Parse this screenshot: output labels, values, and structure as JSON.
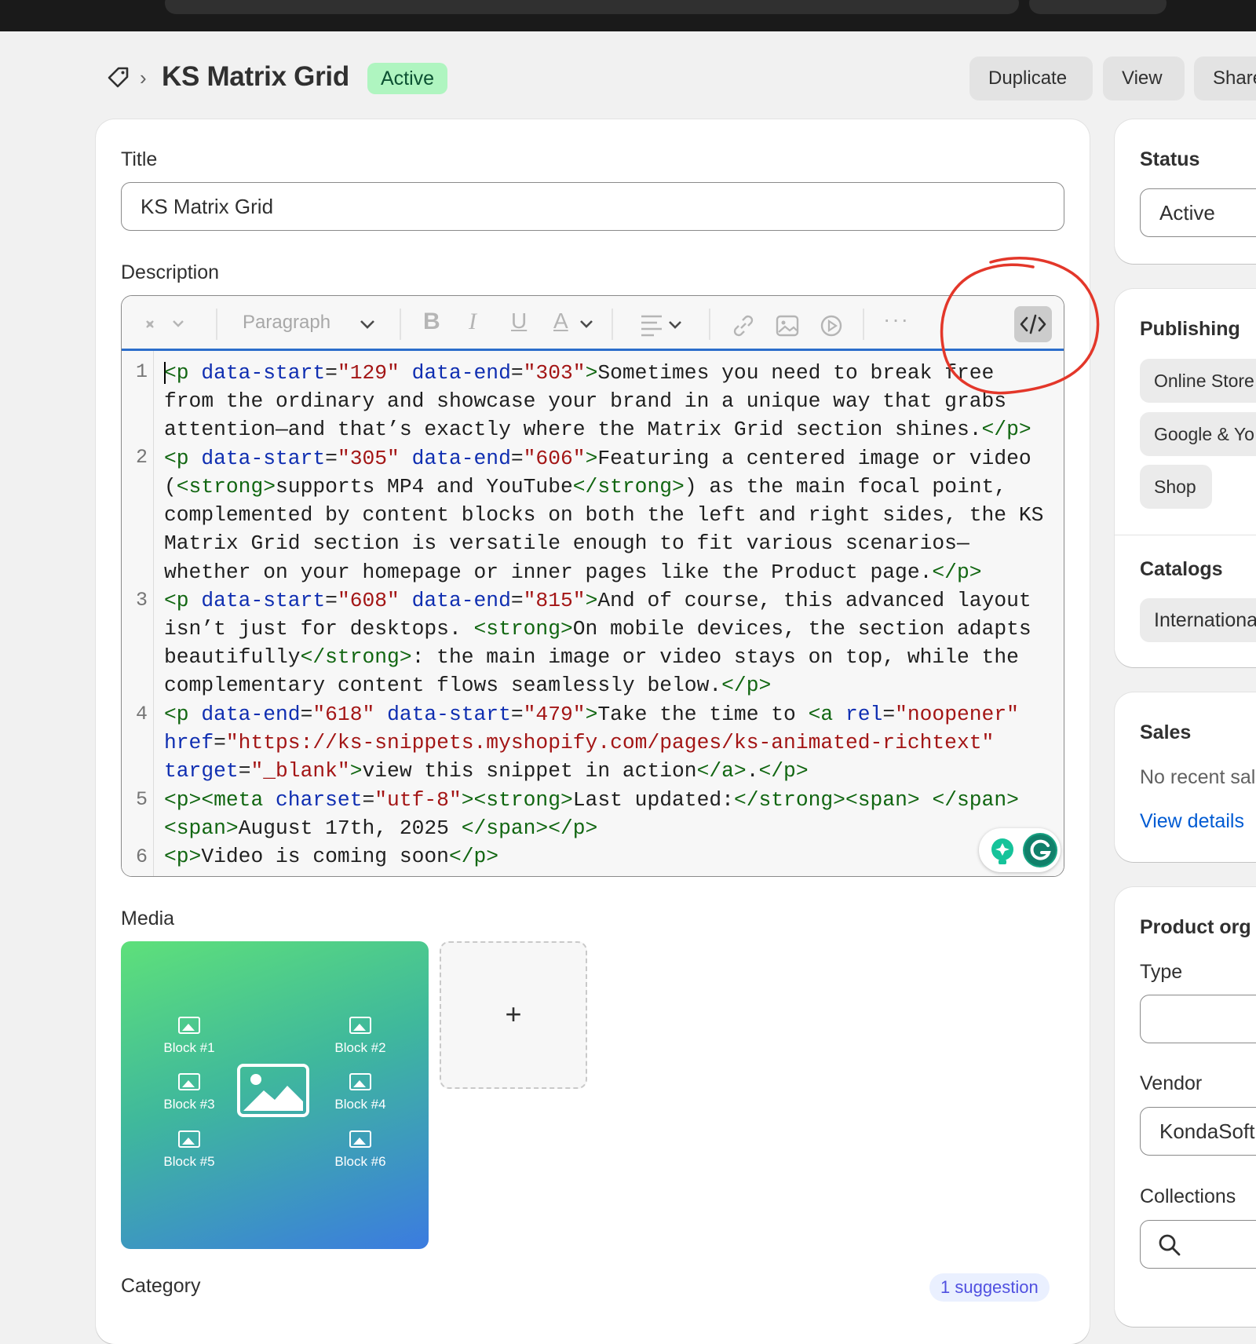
{
  "header": {
    "title": "KS Matrix Grid",
    "status_badge": "Active",
    "buttons": [
      "Duplicate",
      "View",
      "Share"
    ]
  },
  "main": {
    "title_label": "Title",
    "title_value": "KS Matrix Grid",
    "description_label": "Description",
    "toolbar": {
      "paragraph_select": "Paragraph",
      "icons": [
        "magic-icon",
        "bold-icon",
        "italic-icon",
        "underline-icon",
        "text-color-icon",
        "align-icon",
        "link-icon",
        "image-icon",
        "video-icon",
        "more-icon",
        "code-view-icon"
      ]
    },
    "code_line_numbers": [
      "1",
      "2",
      "3",
      "4",
      "5",
      "6"
    ],
    "media_label": "Media",
    "media_blocks": [
      "Block #1",
      "Block #2",
      "Block #3",
      "Block #4",
      "Block #5",
      "Block #6"
    ],
    "media_add": "+",
    "category_label": "Category",
    "category_suggestion": "1 suggestion"
  },
  "sidebar": {
    "status_title": "Status",
    "status_value": "Active",
    "publishing_title": "Publishing",
    "publishing_channels": [
      "Online Store",
      "Google & Yo",
      "Shop"
    ],
    "catalogs_title": "Catalogs",
    "catalogs_value": "International",
    "sales_title": "Sales",
    "sales_text": "No recent sales",
    "sales_link": "View details",
    "product_org_title": "Product org",
    "type_label": "Type",
    "vendor_label": "Vendor",
    "vendor_value": "KondaSoft",
    "collections_label": "Collections"
  },
  "colors": {
    "accent_blue": "#2c6ecb",
    "badge_green": "#aff5c0",
    "annotation_red": "#e3372a"
  }
}
